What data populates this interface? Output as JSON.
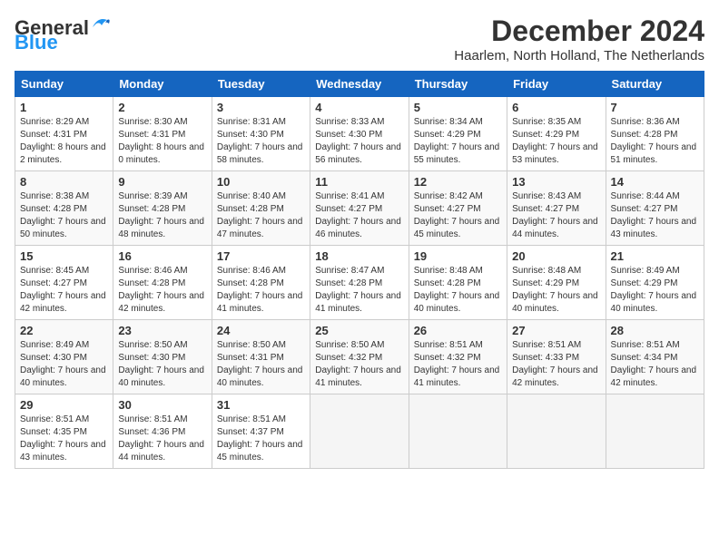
{
  "header": {
    "logo_general": "General",
    "logo_blue": "Blue",
    "month_title": "December 2024",
    "location": "Haarlem, North Holland, The Netherlands"
  },
  "days_of_week": [
    "Sunday",
    "Monday",
    "Tuesday",
    "Wednesday",
    "Thursday",
    "Friday",
    "Saturday"
  ],
  "weeks": [
    [
      {
        "day": "1",
        "sunrise": "8:29 AM",
        "sunset": "4:31 PM",
        "daylight": "8 hours and 2 minutes."
      },
      {
        "day": "2",
        "sunrise": "8:30 AM",
        "sunset": "4:31 PM",
        "daylight": "8 hours and 0 minutes."
      },
      {
        "day": "3",
        "sunrise": "8:31 AM",
        "sunset": "4:30 PM",
        "daylight": "7 hours and 58 minutes."
      },
      {
        "day": "4",
        "sunrise": "8:33 AM",
        "sunset": "4:30 PM",
        "daylight": "7 hours and 56 minutes."
      },
      {
        "day": "5",
        "sunrise": "8:34 AM",
        "sunset": "4:29 PM",
        "daylight": "7 hours and 55 minutes."
      },
      {
        "day": "6",
        "sunrise": "8:35 AM",
        "sunset": "4:29 PM",
        "daylight": "7 hours and 53 minutes."
      },
      {
        "day": "7",
        "sunrise": "8:36 AM",
        "sunset": "4:28 PM",
        "daylight": "7 hours and 51 minutes."
      }
    ],
    [
      {
        "day": "8",
        "sunrise": "8:38 AM",
        "sunset": "4:28 PM",
        "daylight": "7 hours and 50 minutes."
      },
      {
        "day": "9",
        "sunrise": "8:39 AM",
        "sunset": "4:28 PM",
        "daylight": "7 hours and 48 minutes."
      },
      {
        "day": "10",
        "sunrise": "8:40 AM",
        "sunset": "4:28 PM",
        "daylight": "7 hours and 47 minutes."
      },
      {
        "day": "11",
        "sunrise": "8:41 AM",
        "sunset": "4:27 PM",
        "daylight": "7 hours and 46 minutes."
      },
      {
        "day": "12",
        "sunrise": "8:42 AM",
        "sunset": "4:27 PM",
        "daylight": "7 hours and 45 minutes."
      },
      {
        "day": "13",
        "sunrise": "8:43 AM",
        "sunset": "4:27 PM",
        "daylight": "7 hours and 44 minutes."
      },
      {
        "day": "14",
        "sunrise": "8:44 AM",
        "sunset": "4:27 PM",
        "daylight": "7 hours and 43 minutes."
      }
    ],
    [
      {
        "day": "15",
        "sunrise": "8:45 AM",
        "sunset": "4:27 PM",
        "daylight": "7 hours and 42 minutes."
      },
      {
        "day": "16",
        "sunrise": "8:46 AM",
        "sunset": "4:28 PM",
        "daylight": "7 hours and 42 minutes."
      },
      {
        "day": "17",
        "sunrise": "8:46 AM",
        "sunset": "4:28 PM",
        "daylight": "7 hours and 41 minutes."
      },
      {
        "day": "18",
        "sunrise": "8:47 AM",
        "sunset": "4:28 PM",
        "daylight": "7 hours and 41 minutes."
      },
      {
        "day": "19",
        "sunrise": "8:48 AM",
        "sunset": "4:28 PM",
        "daylight": "7 hours and 40 minutes."
      },
      {
        "day": "20",
        "sunrise": "8:48 AM",
        "sunset": "4:29 PM",
        "daylight": "7 hours and 40 minutes."
      },
      {
        "day": "21",
        "sunrise": "8:49 AM",
        "sunset": "4:29 PM",
        "daylight": "7 hours and 40 minutes."
      }
    ],
    [
      {
        "day": "22",
        "sunrise": "8:49 AM",
        "sunset": "4:30 PM",
        "daylight": "7 hours and 40 minutes."
      },
      {
        "day": "23",
        "sunrise": "8:50 AM",
        "sunset": "4:30 PM",
        "daylight": "7 hours and 40 minutes."
      },
      {
        "day": "24",
        "sunrise": "8:50 AM",
        "sunset": "4:31 PM",
        "daylight": "7 hours and 40 minutes."
      },
      {
        "day": "25",
        "sunrise": "8:50 AM",
        "sunset": "4:32 PM",
        "daylight": "7 hours and 41 minutes."
      },
      {
        "day": "26",
        "sunrise": "8:51 AM",
        "sunset": "4:32 PM",
        "daylight": "7 hours and 41 minutes."
      },
      {
        "day": "27",
        "sunrise": "8:51 AM",
        "sunset": "4:33 PM",
        "daylight": "7 hours and 42 minutes."
      },
      {
        "day": "28",
        "sunrise": "8:51 AM",
        "sunset": "4:34 PM",
        "daylight": "7 hours and 42 minutes."
      }
    ],
    [
      {
        "day": "29",
        "sunrise": "8:51 AM",
        "sunset": "4:35 PM",
        "daylight": "7 hours and 43 minutes."
      },
      {
        "day": "30",
        "sunrise": "8:51 AM",
        "sunset": "4:36 PM",
        "daylight": "7 hours and 44 minutes."
      },
      {
        "day": "31",
        "sunrise": "8:51 AM",
        "sunset": "4:37 PM",
        "daylight": "7 hours and 45 minutes."
      },
      null,
      null,
      null,
      null
    ]
  ]
}
